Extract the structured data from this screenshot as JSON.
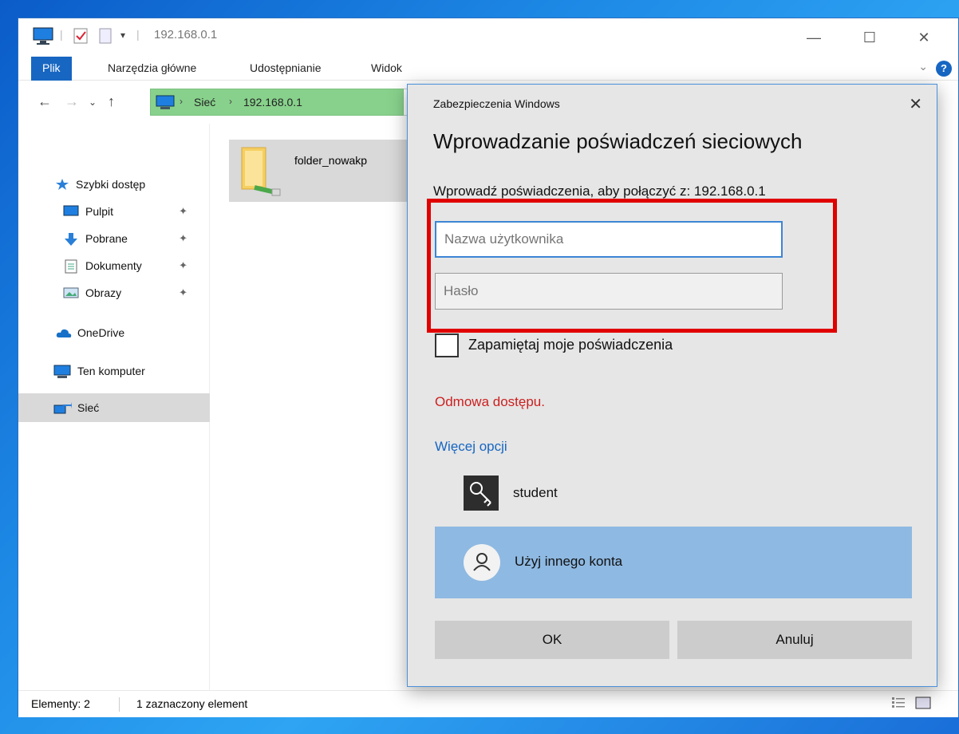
{
  "explorer": {
    "title": "192.168.0.1",
    "ribbon_tabs": [
      "Plik",
      "Narzędzia główne",
      "Udostępnianie",
      "Widok"
    ],
    "breadcrumb": [
      "Sieć",
      "192.168.0.1"
    ],
    "sidebar": {
      "quick_access": "Szybki dostęp",
      "items": [
        {
          "label": "Pulpit",
          "icon": "desktop-icon",
          "pinned": true
        },
        {
          "label": "Pobrane",
          "icon": "download-icon",
          "pinned": true
        },
        {
          "label": "Dokumenty",
          "icon": "document-icon",
          "pinned": true
        },
        {
          "label": "Obrazy",
          "icon": "pictures-icon",
          "pinned": true
        }
      ],
      "onedrive": "OneDrive",
      "this_pc": "Ten komputer",
      "network": "Sieć"
    },
    "files": [
      {
        "name": "folder_nowakp",
        "icon": "shared-folder-icon",
        "selected": true
      }
    ],
    "status": {
      "elements": "Elementy: 2",
      "selected": "1 zaznaczony element"
    }
  },
  "dialog": {
    "app": "Zabezpieczenia Windows",
    "title": "Wprowadzanie poświadczeń sieciowych",
    "message": "Wprowadź poświadczenia, aby połączyć z: 192.168.0.1",
    "username_placeholder": "Nazwa użytkownika",
    "password_placeholder": "Hasło",
    "remember_label": "Zapamiętaj moje poświadczenia",
    "remember_checked": false,
    "error": "Odmowa dostępu.",
    "more_options": "Więcej opcji",
    "accounts": [
      {
        "label": "student",
        "icon": "key-icon"
      },
      {
        "label": "Użyj innego konta",
        "icon": "person-icon",
        "selected": true
      }
    ],
    "ok_label": "OK",
    "cancel_label": "Anuluj"
  },
  "colors": {
    "accent": "#1766c2",
    "address_highlight": "#88d18c",
    "error": "#cc1f1f",
    "annotation_box": "#e00000",
    "selected_account": "#8eb9e2"
  }
}
